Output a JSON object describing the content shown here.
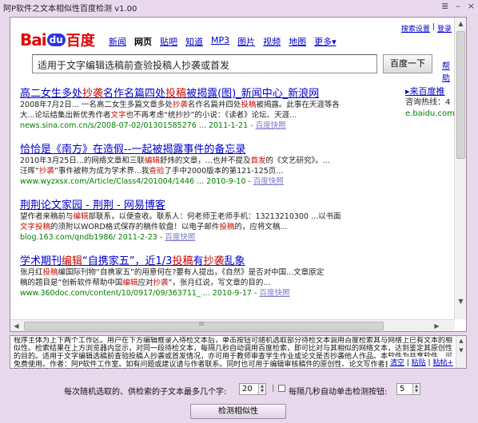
{
  "window": {
    "title": "阿P软件之文本相似性百度检测 v1.00",
    "controls": [
      "≣",
      "–",
      "×"
    ]
  },
  "baidu": {
    "logo_bai": "Bai",
    "logo_paw": "du",
    "logo_cn": "百度",
    "nav": [
      "新闻",
      "网页",
      "贴吧",
      "知道",
      "MP3",
      "图片",
      "视频",
      "地图",
      "更多▾"
    ],
    "nav_active": "网页",
    "top_links": [
      "搜索设置",
      "登录"
    ],
    "search_value": "适用于文字编辑选稿前查验投稿人抄袭或首发",
    "search_button": "百度一下",
    "help_link": "帮助"
  },
  "results": [
    {
      "title_parts": [
        {
          "t": "高二女生多处",
          "hl": false
        },
        {
          "t": "抄袭",
          "hl": true
        },
        {
          "t": "名作名篇四处",
          "hl": false
        },
        {
          "t": "投稿",
          "hl": true
        },
        {
          "t": "被揭露(图)_新闻中心_新浪网",
          "hl": false
        }
      ],
      "lines": [
        [
          {
            "t": "2008年7月2日... 一名高二女生多篇文章多处",
            "hl": false
          },
          {
            "t": "抄袭",
            "hl": true
          },
          {
            "t": "名作名篇并四处",
            "hl": false
          },
          {
            "t": "投稿",
            "hl": true
          },
          {
            "t": "被揭露。此事在天涯等各",
            "hl": false
          }
        ],
        [
          {
            "t": "大...论坛结集出新优秀作者",
            "hl": false
          },
          {
            "t": "文字",
            "hl": true
          },
          {
            "t": "也不再考虑“统抄抄”的小说：《读者》论坛、天涯...",
            "hl": false
          }
        ]
      ],
      "url": "news.sina.com.cn/s/2008-07-02/01301585276 ... 2011-1-21",
      "cache": "百度快照"
    },
    {
      "title_parts": [
        {
          "t": "恰恰是《南方》在造假--一起被揭露事件的备忘录",
          "hl": false
        }
      ],
      "lines": [
        [
          {
            "t": "2010年3月25日...的网络文章和三联",
            "hl": false
          },
          {
            "t": "编辑",
            "hl": true
          },
          {
            "t": "舒炜的文章，...也并不提及",
            "hl": false
          },
          {
            "t": "首发",
            "hl": true
          },
          {
            "t": "的《文艺研究》。...",
            "hl": false
          }
        ],
        [
          {
            "t": "汪晖“",
            "hl": false
          },
          {
            "t": "抄袭",
            "hl": true
          },
          {
            "t": "”事件被称为成为学术界...我",
            "hl": false
          },
          {
            "t": "查验",
            "hl": true
          },
          {
            "t": "了手中2000版本的第121-125页...",
            "hl": false
          }
        ]
      ],
      "url": "www.wyzxsx.com/Article/Class4/201004/1446 ... 2010-9-10",
      "cache": "百度快照"
    },
    {
      "title_parts": [
        {
          "t": "荆荆论文家园 - 荆荆 - 网易博客",
          "hl": false
        }
      ],
      "lines": [
        [
          {
            "t": "望作者来稿前与",
            "hl": false
          },
          {
            "t": "编辑",
            "hl": true
          },
          {
            "t": "部联系，以便查收。联系人：何老师王老师手机：13213210300 ...以书面",
            "hl": false
          }
        ],
        [
          {
            "t": "文字",
            "hl": true
          },
          {
            "t": "投稿",
            "hl": true
          },
          {
            "t": "的须附以WORD格式保存的稿件软盘！以电子邮件",
            "hl": false
          },
          {
            "t": "投稿",
            "hl": true
          },
          {
            "t": "的，应将文稿...",
            "hl": false
          }
        ]
      ],
      "url": "blog.163.com/qndb1986/ 2011-2-23",
      "cache": "百度快照"
    },
    {
      "title_parts": [
        {
          "t": "学术期刊",
          "hl": false
        },
        {
          "t": "编辑",
          "hl": true
        },
        {
          "t": "“自携家五”，近1/3",
          "hl": false
        },
        {
          "t": "投稿",
          "hl": true
        },
        {
          "t": "有",
          "hl": false
        },
        {
          "t": "抄袭",
          "hl": true
        },
        {
          "t": "乱象",
          "hl": false
        }
      ],
      "lines": [
        [
          {
            "t": "张月红",
            "hl": false
          },
          {
            "t": "投稿",
            "hl": true
          },
          {
            "t": "编国际刊物“自携家五”的用意何在?要有人提出，《自然》是否对中国...文章原定",
            "hl": false
          }
        ],
        [
          {
            "t": "稿的题目是“创新软件帮助中国",
            "hl": false
          },
          {
            "t": "编辑",
            "hl": true
          },
          {
            "t": "应对",
            "hl": false
          },
          {
            "t": "抄袭",
            "hl": true
          },
          {
            "t": "”，张月红说，写文章的目的...",
            "hl": false
          }
        ]
      ],
      "url": "www.360doc.com/content/10/0917/09/363711_ ... 2010-9-17",
      "cache": "百度快照"
    }
  ],
  "sidebar": {
    "title": "▸来百度推",
    "line": "咨询热线：4",
    "url": "e.baidu.com"
  },
  "scroll": {
    "up": "▲",
    "down": "▼",
    "left": "◀",
    "right": "▶",
    "grip": "III"
  },
  "textarea": {
    "content": "程序主体为上下两个工作区。用户在下方编辑框录入待检文本后，单击按钮可随机选取部分待检文本调用百度检索其与网络上已有文本的相似性。检索结果在上方浏览器内显示，对同一段待检文本，每隔几秒自动调用百度检索，即可比对与其相似的网络文本，达到鉴定其原创性的目的。适用于文字编辑选稿前查验投稿人抄袭或首发情况，亦可用于教师审查学生作业或论文是否抄袭他人作品。本软件为共享软件，可免费使用。作者：阿P软件工作室。如有问题或建议请与作者联系。同时也可用于编辑审核稿件的原创性、论文写作者自查、高校教师检查作业等用途，欢迎使用并提出宝贵意见。",
    "clear_link": "清空",
    "paste_link": "粘贴",
    "sep": "|",
    "more": "粘帖+"
  },
  "controls": {
    "label_count": "每次随机选取的、供检索的子文本最多几个字:",
    "count_value": "20",
    "sep": "|",
    "auto_checked": false,
    "label_auto": "每隔几秒自动单击检测按钮:",
    "seconds_value": "5",
    "detect_button": "检测相似性"
  },
  "colors": {
    "link": "#0000cc",
    "highlight": "#c60a00",
    "url_green": "#008000",
    "window_bg": "#e8d8ec"
  }
}
